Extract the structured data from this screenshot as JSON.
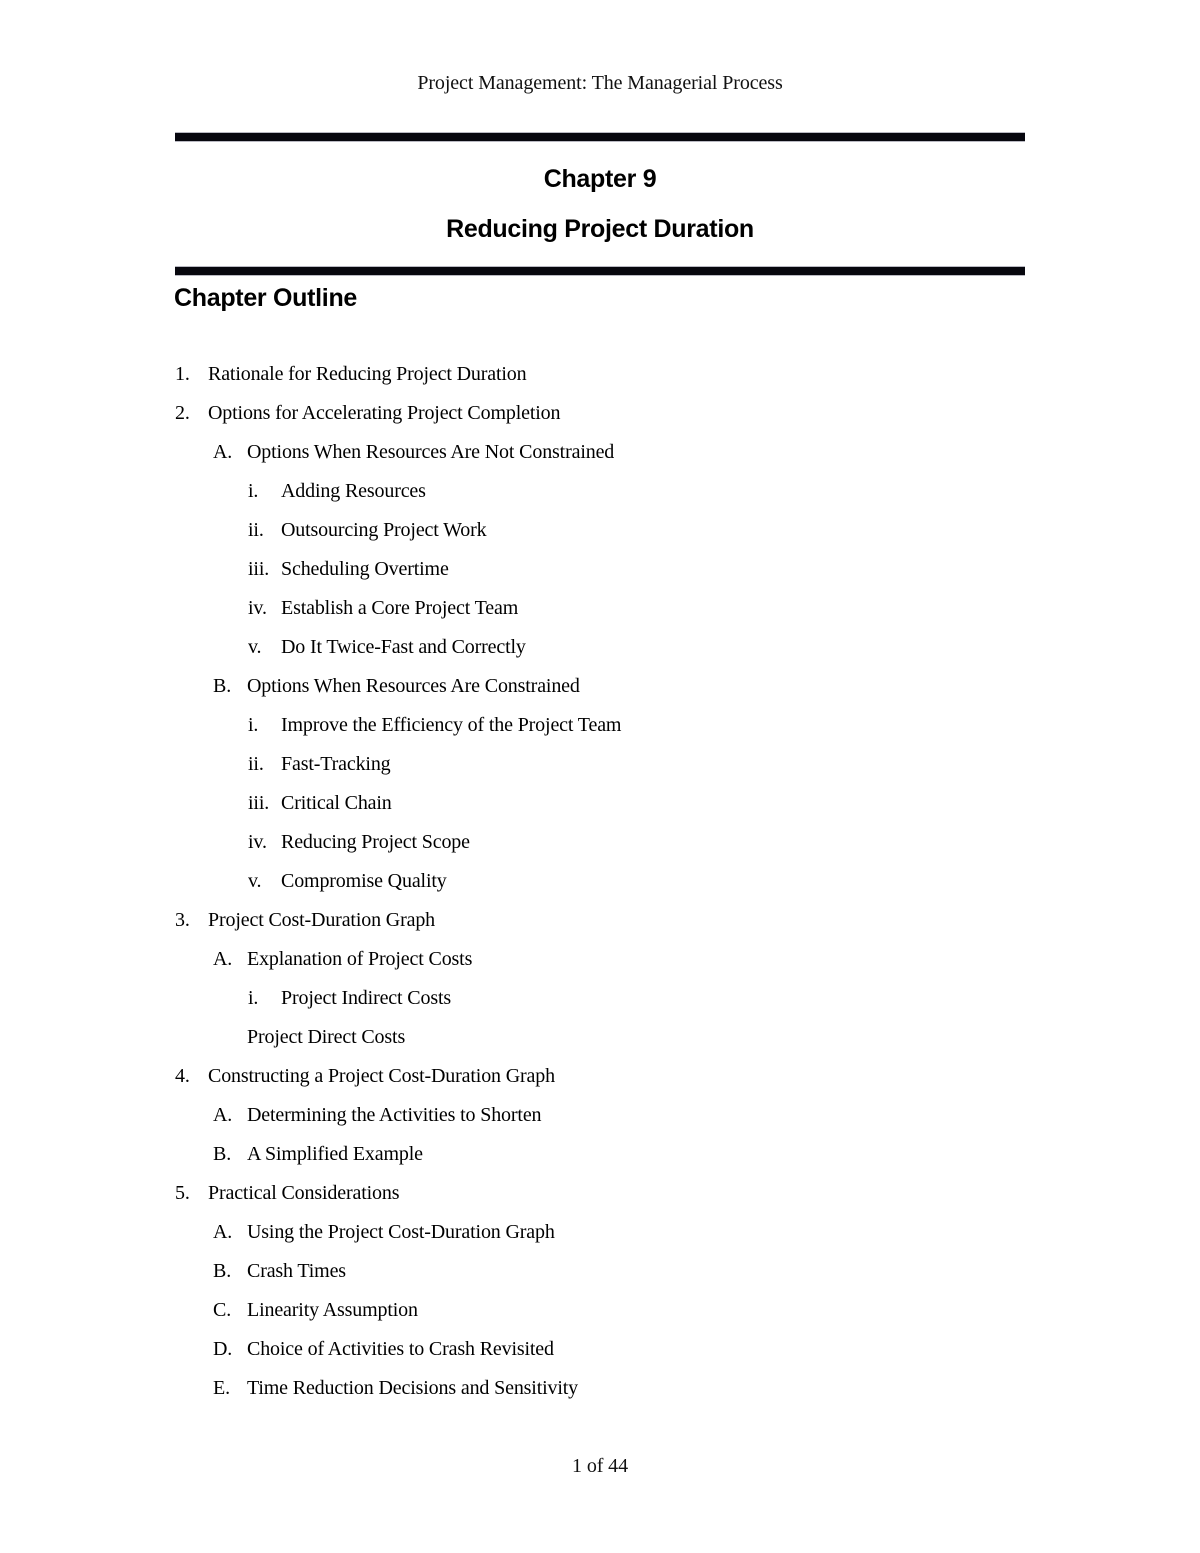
{
  "document": {
    "running_header": "Project Management: The Managerial Process",
    "chapter_number": "Chapter 9",
    "chapter_title": "Reducing Project Duration",
    "section_heading": "Chapter Outline",
    "footer": "1 of 44"
  },
  "outline": [
    {
      "level": 1,
      "marker": "1.",
      "text": "Rationale for Reducing Project Duration"
    },
    {
      "level": 1,
      "marker": "2.",
      "text": "Options for Accelerating Project Completion"
    },
    {
      "level": 2,
      "marker": "A.",
      "text": "Options When Resources Are Not Constrained"
    },
    {
      "level": 3,
      "marker": "i.",
      "text": "Adding Resources"
    },
    {
      "level": 3,
      "marker": "ii.",
      "text": "Outsourcing Project Work"
    },
    {
      "level": 3,
      "marker": "iii.",
      "text": "Scheduling Overtime"
    },
    {
      "level": 3,
      "marker": "iv.",
      "text": "Establish a Core Project Team"
    },
    {
      "level": 3,
      "marker": "v.",
      "text": "Do It Twice-Fast and Correctly"
    },
    {
      "level": 2,
      "marker": "B.",
      "text": "Options When Resources Are Constrained"
    },
    {
      "level": 3,
      "marker": "i.",
      "text": "Improve the Efficiency of the Project Team"
    },
    {
      "level": 3,
      "marker": "ii.",
      "text": "Fast-Tracking"
    },
    {
      "level": 3,
      "marker": "iii.",
      "text": "Critical Chain"
    },
    {
      "level": 3,
      "marker": "iv.",
      "text": "Reducing Project Scope"
    },
    {
      "level": 3,
      "marker": "v.",
      "text": "Compromise Quality"
    },
    {
      "level": 1,
      "marker": "3.",
      "text": "Project Cost-Duration Graph"
    },
    {
      "level": 2,
      "marker": "A.",
      "text": "Explanation of Project Costs"
    },
    {
      "level": 3,
      "marker": "i.",
      "text": "Project Indirect Costs"
    },
    {
      "level": 2,
      "marker": "",
      "text": "Project Direct Costs"
    },
    {
      "level": 1,
      "marker": "4.",
      "text": "Constructing a Project Cost-Duration Graph"
    },
    {
      "level": 2,
      "marker": "A.",
      "text": "Determining the Activities to Shorten"
    },
    {
      "level": 2,
      "marker": "B.",
      "text": "A Simplified Example"
    },
    {
      "level": 1,
      "marker": "5.",
      "text": "Practical Considerations"
    },
    {
      "level": 2,
      "marker": "A.",
      "text": "Using the Project Cost-Duration Graph"
    },
    {
      "level": 2,
      "marker": "B.",
      "text": "Crash Times"
    },
    {
      "level": 2,
      "marker": "C.",
      "text": "Linearity Assumption"
    },
    {
      "level": 2,
      "marker": "D.",
      "text": "Choice of Activities to Crash Revisited"
    },
    {
      "level": 2,
      "marker": "E.",
      "text": "Time Reduction Decisions and Sensitivity"
    }
  ]
}
